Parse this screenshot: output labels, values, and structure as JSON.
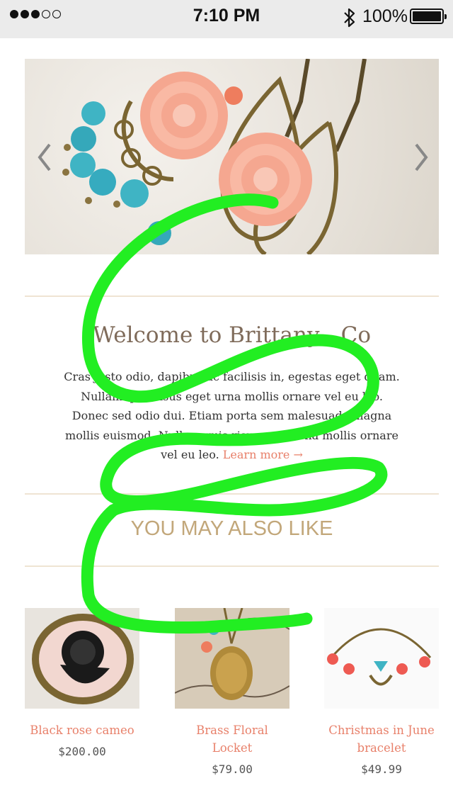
{
  "status_bar": {
    "signal_filled": 3,
    "signal_total": 5,
    "time": "7:10 PM",
    "battery_text": "100%",
    "battery_level": 1.0
  },
  "hero": {
    "prev_icon": "chevron-left-icon",
    "next_icon": "chevron-right-icon"
  },
  "welcome": {
    "title": "Welcome to Brittany - Co",
    "body": "Cras justo odio, dapibus ac facilisis in, egestas eget quam. Nullam quis risus eget urna mollis ornare vel eu leo. Donec sed odio dui. Etiam porta sem malesuada magna mollis euismod. Nullam quis risus eget urna mollis ornare vel eu leo.",
    "learn_more": "Learn more →"
  },
  "also_like": {
    "heading": "YOU MAY ALSO LIKE"
  },
  "products": [
    {
      "name": "Black rose cameo",
      "price": "$200.00"
    },
    {
      "name": "Brass Floral Locket",
      "price": "$79.00"
    },
    {
      "name": "Christmas in June bracelet",
      "price": "$49.99"
    }
  ],
  "colors": {
    "accent": "#e8806a",
    "heading": "#c2a77a",
    "scribble": "#22ee22"
  }
}
